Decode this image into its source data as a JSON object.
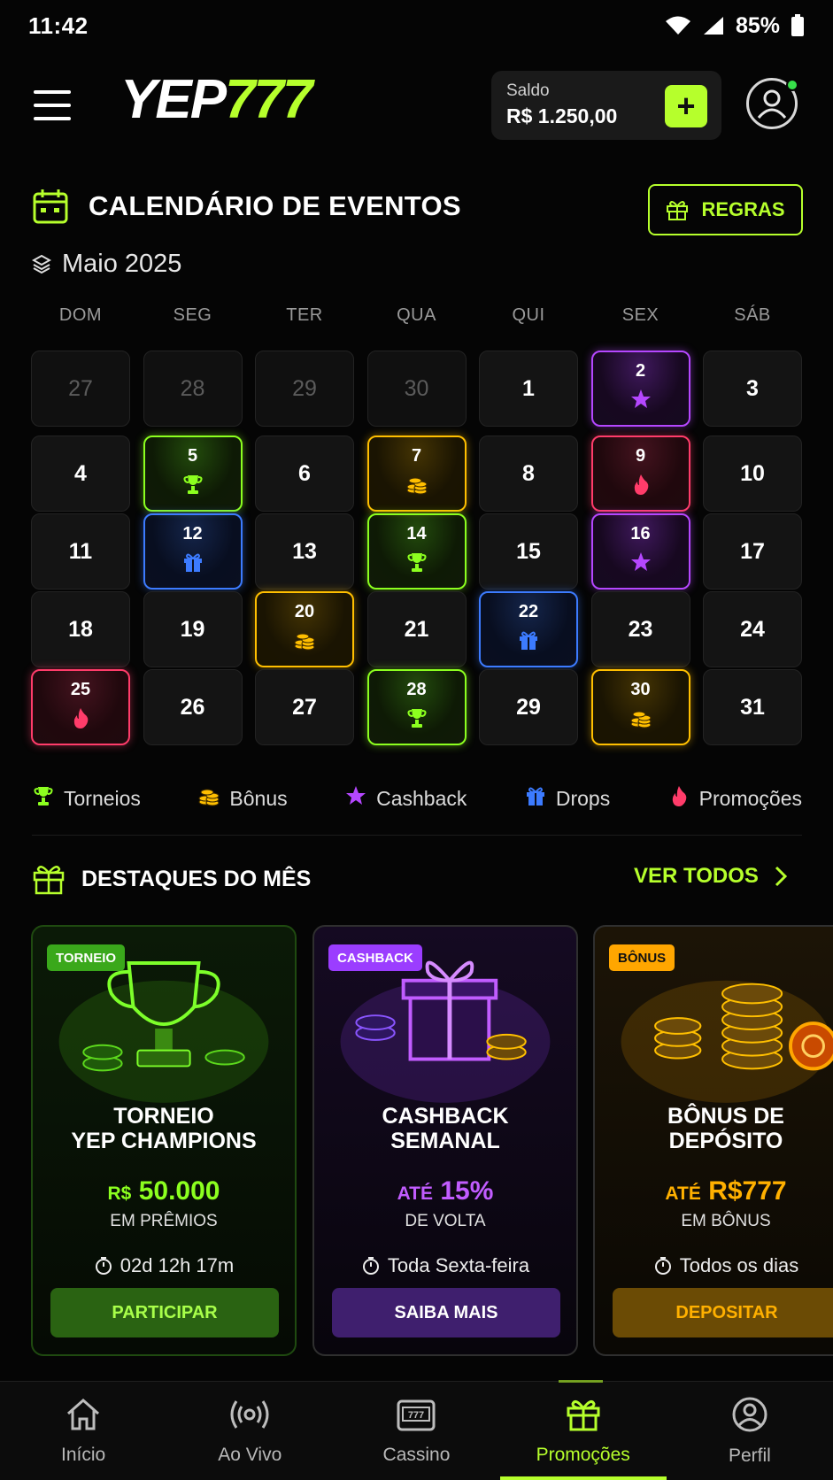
{
  "status": {
    "time": "11:42",
    "battery": "85%"
  },
  "header": {
    "logo_white": "YEP",
    "logo_green": "777",
    "balance_label": "Saldo",
    "balance_value": "R$ 1.250,00",
    "add_label": "+"
  },
  "calendar": {
    "title": "CALENDÁRIO DE EVENTOS",
    "rules_label": "REGRAS",
    "month": "Maio 2025",
    "weekdays": [
      "DOM",
      "SEG",
      "TER",
      "QUA",
      "QUI",
      "SEX",
      "SÁB"
    ],
    "days": [
      {
        "n": "27",
        "dim": true
      },
      {
        "n": "28",
        "dim": true
      },
      {
        "n": "29",
        "dim": true
      },
      {
        "n": "30",
        "dim": true
      },
      {
        "n": "1"
      },
      {
        "n": "2",
        "ev": "cashback"
      },
      {
        "n": "3"
      },
      {
        "n": "4"
      },
      {
        "n": "5",
        "ev": "torneio"
      },
      {
        "n": "6"
      },
      {
        "n": "7",
        "ev": "bonus"
      },
      {
        "n": "8"
      },
      {
        "n": "9",
        "ev": "promo"
      },
      {
        "n": "10"
      },
      {
        "n": "11"
      },
      {
        "n": "12",
        "ev": "drops"
      },
      {
        "n": "13"
      },
      {
        "n": "14",
        "ev": "torneio"
      },
      {
        "n": "15"
      },
      {
        "n": "16",
        "ev": "cashback"
      },
      {
        "n": "17"
      },
      {
        "n": "18"
      },
      {
        "n": "19"
      },
      {
        "n": "20",
        "ev": "bonus"
      },
      {
        "n": "21"
      },
      {
        "n": "22",
        "ev": "drops"
      },
      {
        "n": "23"
      },
      {
        "n": "24"
      },
      {
        "n": "25",
        "ev": "promo"
      },
      {
        "n": "26"
      },
      {
        "n": "27"
      },
      {
        "n": "28",
        "ev": "torneio"
      },
      {
        "n": "29"
      },
      {
        "n": "30",
        "ev": "bonus"
      },
      {
        "n": "31"
      }
    ],
    "legend": [
      {
        "label": "Torneios",
        "icon": "trophy-icon",
        "color": "#8cff1f"
      },
      {
        "label": "Bônus",
        "icon": "coins-icon",
        "color": "#ffbf00"
      },
      {
        "label": "Cashback",
        "icon": "star-icon",
        "color": "#b547ff"
      },
      {
        "label": "Drops",
        "icon": "gift-icon",
        "color": "#3c7bff"
      },
      {
        "label": "Promoções",
        "icon": "fire-icon",
        "color": "#ff3c6a"
      }
    ]
  },
  "highlights": {
    "title": "DESTAQUES DO MÊS",
    "see_all": "VER TODOS",
    "cards": [
      {
        "tag": "TORNEIO",
        "title1": "TORNEIO",
        "title2": "YEP CHAMPIONS",
        "amount_prefix": "R$",
        "amount": "50.000",
        "sub": "EM PRÊMIOS",
        "timer": "02d 12h 17m",
        "cta": "PARTICIPAR"
      },
      {
        "tag": "CASHBACK",
        "title1": "CASHBACK",
        "title2": "SEMANAL",
        "amount_prefix": "ATÉ",
        "amount": "15%",
        "sub": "DE VOLTA",
        "timer": "Toda Sexta-feira",
        "cta": "SAIBA MAIS"
      },
      {
        "tag": "BÔNUS",
        "title1": "BÔNUS DE",
        "title2": "DEPÓSITO",
        "amount_prefix": "ATÉ",
        "amount": "R$777",
        "sub": "EM BÔNUS",
        "timer": "Todos os dias",
        "cta": "DEPOSITAR"
      }
    ]
  },
  "nav": [
    {
      "label": "Início",
      "icon": "home-icon"
    },
    {
      "label": "Ao Vivo",
      "icon": "live-icon"
    },
    {
      "label": "Cassino",
      "icon": "slot-machine-icon"
    },
    {
      "label": "Promoções",
      "icon": "gift-icon",
      "active": true
    },
    {
      "label": "Perfil",
      "icon": "user-icon"
    }
  ]
}
